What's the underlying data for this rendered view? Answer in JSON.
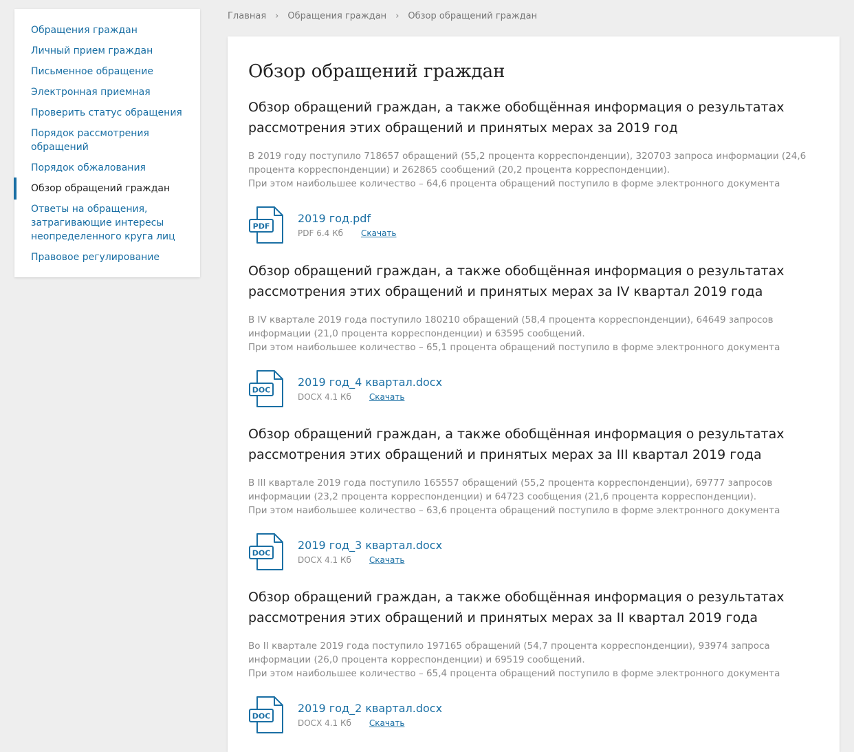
{
  "colors": {
    "accent": "#1a6fa4",
    "background": "#eeeeee",
    "muted_text": "#8a8a8a"
  },
  "sidebar": {
    "items": [
      {
        "label": "Обращения граждан",
        "active": false
      },
      {
        "label": "Личный прием граждан",
        "active": false
      },
      {
        "label": "Письменное обращение",
        "active": false
      },
      {
        "label": "Электронная приемная",
        "active": false
      },
      {
        "label": "Проверить статус обращения",
        "active": false
      },
      {
        "label": "Порядок рассмотрения обращений",
        "active": false
      },
      {
        "label": "Порядок обжалования",
        "active": false
      },
      {
        "label": "Обзор обращений граждан",
        "active": true
      },
      {
        "label": "Ответы на обращения, затрагивающие интересы неопределенного круга лиц",
        "active": false
      },
      {
        "label": "Правовое регулирование",
        "active": false
      }
    ]
  },
  "breadcrumb": {
    "items": [
      "Главная",
      "Обращения граждан",
      "Обзор обращений граждан"
    ],
    "separator": "›"
  },
  "main": {
    "title": "Обзор обращений граждан",
    "sections": [
      {
        "title": "Обзор обращений граждан, а также обобщённая информация о результатах рассмотрения этих обращений и принятых мерах за 2019 год",
        "text_lines": [
          "В 2019 году поступило 718657 обращений (55,2 процента корреспонденции), 320703 запроса информации (24,6",
          "процента корреспонденции) и 262865 сообщений (20,2 процента корреспонденции).",
          "При этом наибольшее количество – 64,6 процента обращений поступило в форме электронного документа"
        ],
        "file": {
          "icon_label": "PDF",
          "icon": "pdf-file-icon",
          "name": "2019 год.pdf",
          "meta": "PDF 6.4 Кб",
          "download": "Скачать"
        }
      },
      {
        "title": "Обзор обращений граждан, а также обобщённая информация о результатах рассмотрения этих обращений и принятых мерах за IV квартал 2019 года",
        "text_lines": [
          "В IV квартале 2019 года поступило 180210 обращений (58,4 процента корреспонденции), 64649 запросов",
          "информации (21,0 процента корреспонденции) и 63595 сообщений.",
          "При этом наибольшее количество – 65,1 процента обращений поступило в форме электронного документа"
        ],
        "file": {
          "icon_label": "DOC",
          "icon": "doc-file-icon",
          "name": "2019 год_4 квартал.docx",
          "meta": "DOCX 4.1 Кб",
          "download": "Скачать"
        }
      },
      {
        "title": "Обзор обращений граждан, а также обобщённая информация о результатах рассмотрения этих обращений и принятых мерах за III квартал 2019 года",
        "text_lines": [
          "В III квартале 2019 года поступило 165557 обращений (55,2 процента корреспонденции), 69777 запросов",
          "информации (23,2 процента корреспонденции) и 64723 сообщения (21,6 процента корреспонденции).",
          "При этом наибольшее количество – 63,6 процента обращений поступило в форме электронного документа"
        ],
        "file": {
          "icon_label": "DOC",
          "icon": "doc-file-icon",
          "name": "2019 год_3 квартал.docx",
          "meta": "DOCX 4.1 Кб",
          "download": "Скачать"
        }
      },
      {
        "title": "Обзор обращений граждан, а также обобщённая информация о результатах рассмотрения этих обращений и принятых мерах за II квартал 2019 года",
        "text_lines": [
          "Во II квартале 2019 года поступило 197165 обращений (54,7 процента корреспонденции), 93974 запроса",
          "информации (26,0 процента корреспонденции) и 69519 сообщений.",
          "При этом наибольшее количество – 65,4 процента обращений поступило в форме электронного документа"
        ],
        "file": {
          "icon_label": "DOC",
          "icon": "doc-file-icon",
          "name": "2019 год_2 квартал.docx",
          "meta": "DOCX 4.1 Кб",
          "download": "Скачать"
        }
      }
    ]
  }
}
